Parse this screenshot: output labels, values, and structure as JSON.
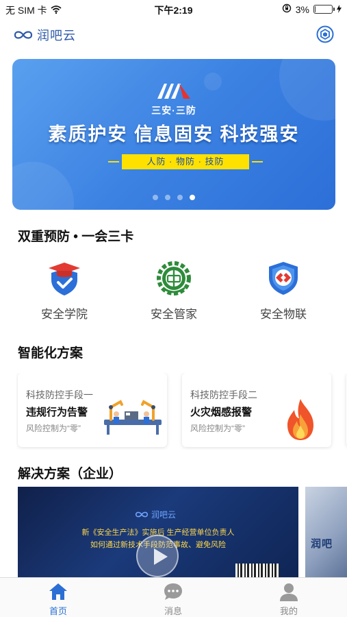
{
  "status_bar": {
    "carrier": "无 SIM 卡",
    "time": "下午2:19",
    "battery_percent": "3%",
    "battery_level": 0.03
  },
  "header": {
    "logo_text": "润吧云",
    "scan_icon": "scan-icon"
  },
  "banner": {
    "brand_name": "三安·三防",
    "slogan": "素质护安  信息固安  科技强安",
    "tagline": "人防 · 物防 · 技防",
    "page_count": 4,
    "active_index": 3
  },
  "section_prevention": {
    "title": "双重预防 • 一会三卡",
    "items": [
      {
        "label": "安全学院",
        "icon": "academy-shield-icon"
      },
      {
        "label": "安全管家",
        "icon": "butler-gear-icon"
      },
      {
        "label": "安全物联",
        "icon": "iot-shield-icon"
      }
    ]
  },
  "section_smart": {
    "title": "智能化方案",
    "cards": [
      {
        "kicker": "科技防控手段一",
        "title": "违规行为告警",
        "desc": "风险控制为“零”",
        "art": "robot-assembly-icon"
      },
      {
        "kicker": "科技防控手段二",
        "title": "火灾烟感报警",
        "desc": "风险控制为“零”",
        "art": "fire-icon"
      }
    ]
  },
  "section_solutions": {
    "title": "解决方案（企业）",
    "video": {
      "brand": "润吧云",
      "line1": "新《安全生产法》实施后  生产经营单位负责人",
      "line2": "如何通过新技术手段防范事故、避免风险"
    },
    "peek_text": "润吧"
  },
  "tabbar": {
    "tabs": [
      {
        "label": "首页",
        "icon": "home-icon",
        "active": true
      },
      {
        "label": "消息",
        "icon": "message-icon",
        "active": false
      },
      {
        "label": "我的",
        "icon": "profile-icon",
        "active": false
      }
    ]
  },
  "colors": {
    "accent": "#2b6fd4",
    "banner_blue": "#3c82e2",
    "tag_yellow": "#ffe100"
  }
}
